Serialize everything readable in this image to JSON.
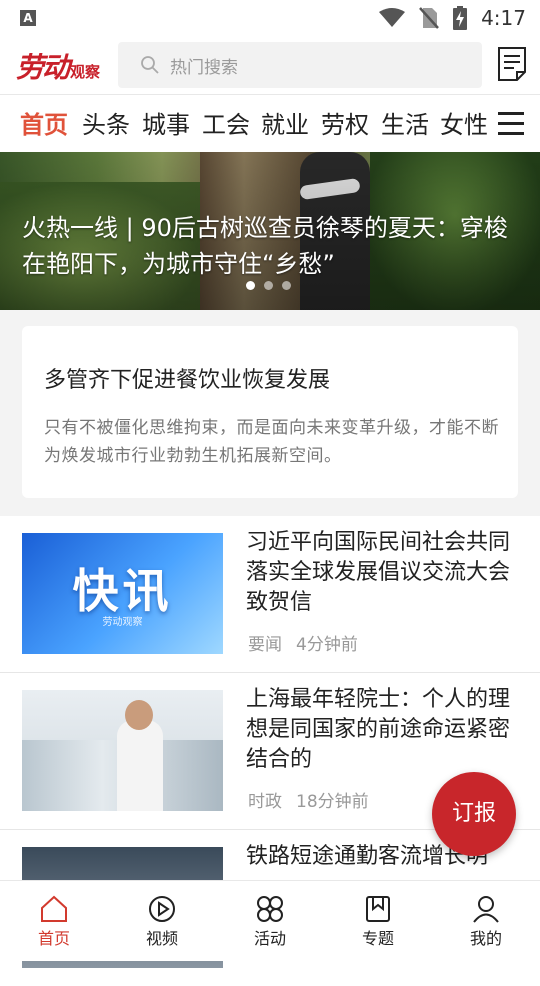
{
  "status_bar": {
    "time": "4:17",
    "badge": "A"
  },
  "header": {
    "logo_main": "劳动",
    "logo_sub": "观察",
    "search_placeholder": "热门搜索"
  },
  "tabs": [
    "首页",
    "头条",
    "城事",
    "工会",
    "就业",
    "劳权",
    "生活",
    "女性"
  ],
  "active_tab": "首页",
  "banner": {
    "title": "火热一线 | 90后古树巡查员徐琴的夏天：穿梭在艳阳下，为城市守住“乡愁”",
    "slide_count": 3,
    "active_slide": 1
  },
  "feature_card": {
    "title": "多管齐下促进餐饮业恢复发展",
    "body": "只有不被僵化思维拘束，而是面向未来变革升级，才能不断为焕发城市行业勃勃生机拓展新空间。"
  },
  "news": [
    {
      "title": "习近平向国际民间社会共同落实全球发展倡议交流大会致贺信",
      "category": "要闻",
      "time": "4分钟前",
      "thumb_text": "快讯",
      "thumb_sub": "劳动观察"
    },
    {
      "title": "上海最年轻院士：个人的理想是同国家的前途命运紧密结合的",
      "category": "时政",
      "time": "18分钟前"
    },
    {
      "title": "铁路短途通勤客流增长明",
      "category": "",
      "time": ""
    }
  ],
  "fab_label": "订报",
  "bottom_nav": [
    {
      "label": "首页",
      "icon": "home-icon"
    },
    {
      "label": "视频",
      "icon": "play-icon"
    },
    {
      "label": "活动",
      "icon": "activity-icon"
    },
    {
      "label": "专题",
      "icon": "bookmark-icon"
    },
    {
      "label": "我的",
      "icon": "user-icon"
    }
  ],
  "colors": {
    "accent": "#e0523a",
    "brand": "#c8202a",
    "fab": "#c8262b"
  }
}
